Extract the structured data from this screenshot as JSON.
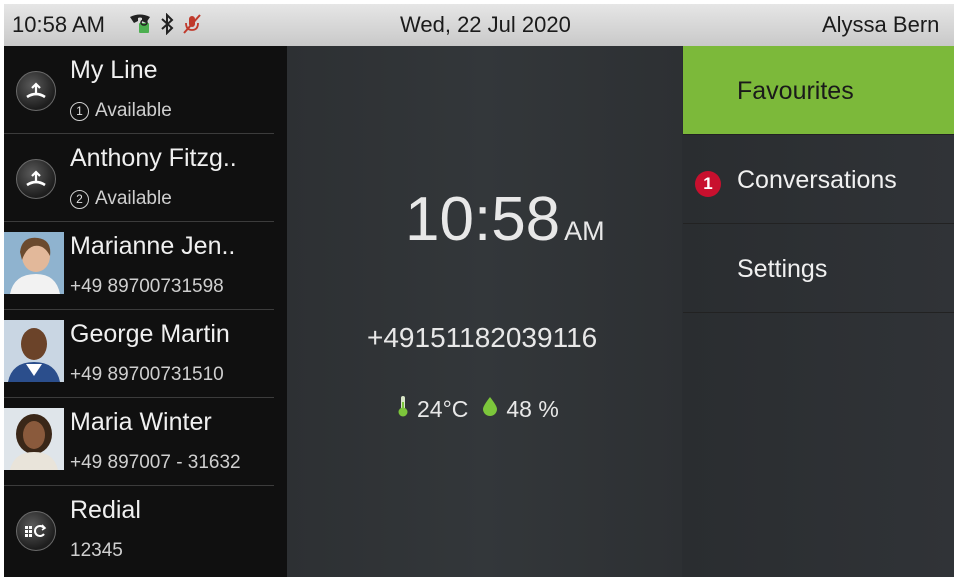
{
  "status_bar": {
    "time": "10:58 AM",
    "date": "Wed, 22 Jul 2020",
    "user": "Alyssa Bern",
    "icons": [
      "phone-lock-icon",
      "bluetooth-icon",
      "mic-muted-icon"
    ]
  },
  "lines": [
    {
      "name": "My Line",
      "line_number": "1",
      "status": "Available",
      "icon": "line-key-icon"
    },
    {
      "name": "Anthony Fitzg..",
      "line_number": "2",
      "status": "Available",
      "icon": "line-key-icon"
    },
    {
      "name": "Marianne Jen..",
      "number": "+49 89700731598",
      "icon": "contact-photo"
    },
    {
      "name": "George Martin",
      "number": "+49 89700731510",
      "icon": "contact-photo"
    },
    {
      "name": "Maria Winter",
      "number": "+49 897007 - 31632",
      "icon": "contact-photo"
    },
    {
      "name": "Redial",
      "number": "12345",
      "icon": "redial-icon"
    }
  ],
  "idle": {
    "clock": "10:58",
    "ampm": "AM",
    "phone_number": "+49151182039116",
    "temperature": "24°C",
    "humidity": "48 %"
  },
  "menu": [
    {
      "label": "Favourites",
      "active": true
    },
    {
      "label": "Conversations",
      "badge": "1"
    },
    {
      "label": "Settings"
    }
  ],
  "colors": {
    "active_menu": "#7cb93a",
    "badge": "#c8102e",
    "drop": "#7cc63b"
  }
}
